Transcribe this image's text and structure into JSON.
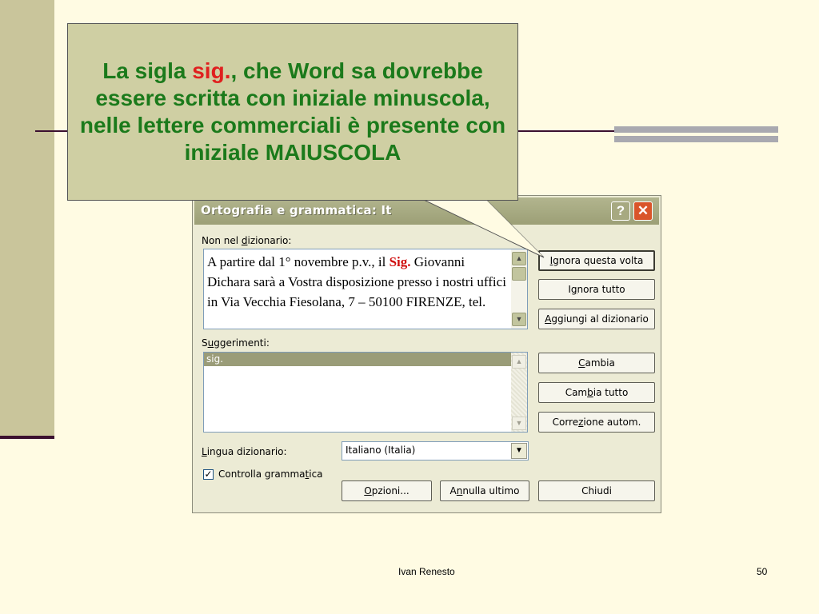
{
  "callout": {
    "text_before": "La sigla ",
    "highlight": "sig.",
    "text_after": ", che Word sa dovrebbe essere scritta con iniziale minuscola, nelle lettere commerciali è presente con iniziale MAIUSCOLA"
  },
  "dialog": {
    "title": "Ortografia e grammatica: It",
    "help_label": "?",
    "close_label": "✕",
    "not_in_dict_label": {
      "pre": "Non nel ",
      "key": "d",
      "post": "izionario:"
    },
    "text_before": "A partire dal 1° novembre p.v., il ",
    "text_sig": "Sig.",
    "text_after": " Giovanni Dichara sarà a Vostra disposizione presso i nostri uffici in Via Vecchia Fiesolana, 7 – 50100 FIRENZE, tel.",
    "suggestions_label": {
      "pre": "S",
      "key": "u",
      "post": "ggerimenti:"
    },
    "suggestions": [
      "sig."
    ],
    "lang_label": {
      "pre": "",
      "key": "L",
      "post": "ingua dizionario:"
    },
    "lang_value": "Italiano (Italia)",
    "grammar_check": {
      "pre": "Controlla gramma",
      "key": "t",
      "post": "ica",
      "checked": true
    },
    "buttons": {
      "ignore_once": {
        "pre": "",
        "key": "I",
        "post": "gnora questa volta"
      },
      "ignore_all": {
        "pre": "I",
        "key": "g",
        "post": "nora tutto"
      },
      "add_dict": {
        "pre": "",
        "key": "A",
        "post": "ggiungi al dizionario"
      },
      "change": {
        "pre": "",
        "key": "C",
        "post": "ambia"
      },
      "change_all": {
        "pre": "Cam",
        "key": "b",
        "post": "ia tutto"
      },
      "autocorrect": {
        "pre": "Corre",
        "key": "z",
        "post": "ione autom."
      },
      "options": {
        "pre": "",
        "key": "O",
        "post": "pzioni..."
      },
      "undo": {
        "pre": "A",
        "key": "n",
        "post": "nulla ultimo"
      },
      "close": {
        "pre": "",
        "key": "",
        "post": "Chiudi"
      }
    }
  },
  "footer": {
    "author": "Ivan Renesto",
    "page": "50"
  }
}
